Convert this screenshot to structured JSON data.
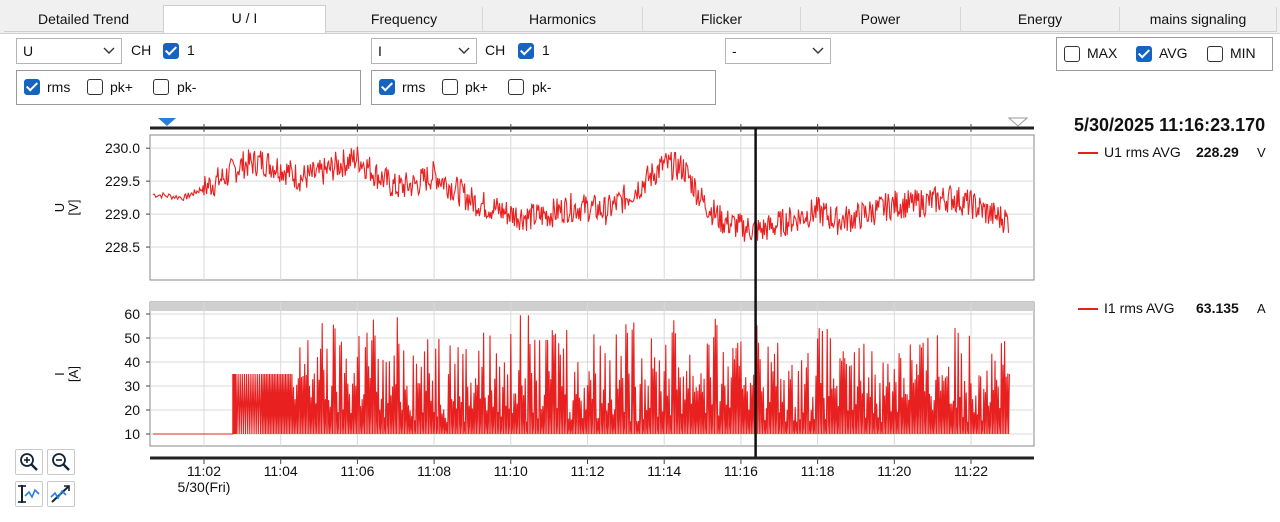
{
  "tabs": [
    "Detailed Trend",
    "U / I",
    "Frequency",
    "Harmonics",
    "Flicker",
    "Power",
    "Energy",
    "mains signaling"
  ],
  "left_controls": {
    "quantity": "U",
    "ch_label": "CH",
    "channel": "1",
    "options": [
      {
        "label": "rms",
        "checked": true
      },
      {
        "label": "pk+",
        "checked": false
      },
      {
        "label": "pk-",
        "checked": false
      }
    ]
  },
  "right_controls": {
    "quantity": "I",
    "ch_label": "CH",
    "channel": "1",
    "options": [
      {
        "label": "rms",
        "checked": true
      },
      {
        "label": "pk+",
        "checked": false
      },
      {
        "label": "pk-",
        "checked": false
      }
    ]
  },
  "third_select": "-",
  "stat_options": [
    {
      "label": "MAX",
      "checked": false
    },
    {
      "label": "AVG",
      "checked": true
    },
    {
      "label": "MIN",
      "checked": false
    }
  ],
  "cursor": {
    "timestamp": "5/30/2025 11:16:23.170",
    "u_label": "U1 rms AVG",
    "u_value": "228.29",
    "u_unit": "V",
    "i_label": "I1 rms AVG",
    "i_value": "63.135",
    "i_unit": "A"
  },
  "x_axis": {
    "ticks": [
      "11:02",
      "11:04",
      "11:06",
      "11:08",
      "11:10",
      "11:12",
      "11:14",
      "11:16",
      "11:18",
      "11:20",
      "11:22"
    ],
    "date_label": "5/30(Fri)"
  },
  "colors": {
    "trace": "#e82020",
    "checkbox": "#1565c0",
    "cursor_marker": "#2a7fdc"
  },
  "chart_data": [
    {
      "type": "line",
      "ylabel": "U\n[V]",
      "series": [
        {
          "name": "U1 rms AVG",
          "color": "#e82020"
        }
      ],
      "yticks": [
        228.5,
        229.0,
        229.5,
        230.0
      ],
      "ylim": [
        228.0,
        230.2
      ],
      "x_range": [
        "11:00:40",
        "11:23:10"
      ],
      "cursor_x": "11:16:23",
      "x": [
        "11:00:40",
        "11:01:30",
        "11:02:00",
        "11:02:30",
        "11:03:00",
        "11:03:30",
        "11:04:00",
        "11:04:30",
        "11:05:00",
        "11:05:30",
        "11:06:00",
        "11:06:30",
        "11:07:00",
        "11:07:30",
        "11:08:00",
        "11:08:30",
        "11:09:00",
        "11:09:30",
        "11:10:00",
        "11:10:30",
        "11:11:00",
        "11:11:30",
        "11:12:00",
        "11:12:30",
        "11:13:00",
        "11:13:30",
        "11:14:00",
        "11:14:30",
        "11:15:00",
        "11:15:30",
        "11:16:00",
        "11:16:30",
        "11:17:00",
        "11:17:30",
        "11:18:00",
        "11:18:30",
        "11:19:00",
        "11:19:30",
        "11:20:00",
        "11:20:30",
        "11:21:00",
        "11:21:30",
        "11:22:00",
        "11:22:30",
        "11:23:00"
      ],
      "values": [
        229.3,
        229.25,
        229.4,
        229.55,
        229.75,
        229.8,
        229.7,
        229.55,
        229.6,
        229.75,
        229.85,
        229.6,
        229.4,
        229.45,
        229.6,
        229.4,
        229.2,
        229.1,
        229.0,
        228.95,
        229.0,
        229.1,
        229.1,
        229.05,
        229.25,
        229.5,
        229.75,
        229.7,
        229.2,
        228.9,
        228.8,
        228.75,
        228.85,
        228.95,
        229.05,
        228.9,
        228.95,
        229.05,
        229.15,
        229.15,
        229.2,
        229.25,
        229.15,
        229.0,
        228.9
      ]
    },
    {
      "type": "line",
      "ylabel": "I\n[A]",
      "series": [
        {
          "name": "I1 rms AVG",
          "color": "#e82020"
        }
      ],
      "yticks": [
        10,
        20,
        30,
        40,
        50,
        60
      ],
      "ylim": [
        5,
        65
      ],
      "x_range": [
        "11:00:40",
        "11:23:10"
      ],
      "cursor_x": "11:16:23",
      "x": [
        "11:00:40",
        "11:02:45",
        "11:02:50",
        "11:03:30",
        "11:04:00",
        "11:04:30",
        "11:05:00",
        "11:05:30",
        "11:06:00",
        "11:06:30",
        "11:07:00",
        "11:07:30",
        "11:08:00",
        "11:08:30",
        "11:09:00",
        "11:09:30",
        "11:10:00",
        "11:10:30",
        "11:11:00",
        "11:11:30",
        "11:12:00",
        "11:12:30",
        "11:13:00",
        "11:13:30",
        "11:14:00",
        "11:14:30",
        "11:15:00",
        "11:15:30",
        "11:16:00",
        "11:16:30",
        "11:17:00",
        "11:17:30",
        "11:18:00",
        "11:18:30",
        "11:19:00",
        "11:19:30",
        "11:20:00",
        "11:20:30",
        "11:21:00",
        "11:21:30",
        "11:22:00",
        "11:22:30",
        "11:23:00"
      ],
      "values": [
        10,
        10,
        35,
        35,
        35,
        55,
        58,
        50,
        63,
        45,
        60,
        50,
        58,
        50,
        55,
        45,
        60,
        50,
        62,
        45,
        55,
        52,
        58,
        50,
        60,
        52,
        58,
        48,
        60,
        50,
        40,
        48,
        55,
        45,
        50,
        45,
        58,
        52,
        60,
        55,
        62,
        50,
        35
      ]
    }
  ]
}
